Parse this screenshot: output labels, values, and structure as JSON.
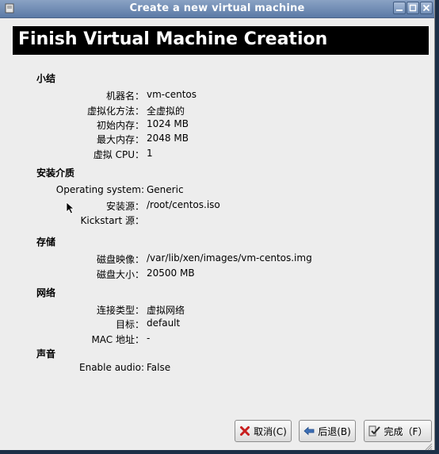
{
  "window": {
    "title": "Create a new virtual machine",
    "controls": [
      "window-menu-icon",
      "minimize-icon",
      "maximize-icon",
      "close-icon"
    ]
  },
  "banner": {
    "title": "Finish Virtual Machine Creation"
  },
  "summary": {
    "heading": "小结",
    "rows": [
      {
        "label": "机器名：",
        "value": "vm-centos"
      },
      {
        "label": "虚拟化方法：",
        "value": "全虚拟的"
      },
      {
        "label": "初始内存：",
        "value": "1024 MB"
      },
      {
        "label": "最大内存：",
        "value": "2048 MB"
      },
      {
        "label": "虚拟 CPU：",
        "value": "1"
      }
    ]
  },
  "install_media": {
    "heading": "安装介质",
    "rows": [
      {
        "label": "Operating system:",
        "value": "Generic"
      },
      {
        "label": "安装源：",
        "value": "/root/centos.iso"
      },
      {
        "label": "Kickstart 源：",
        "value": ""
      }
    ]
  },
  "storage": {
    "heading": "存储",
    "rows": [
      {
        "label": "磁盘映像：",
        "value": "/var/lib/xen/images/vm-centos.img"
      },
      {
        "label": "磁盘大小：",
        "value": "20500 MB"
      }
    ]
  },
  "network": {
    "heading": "网络",
    "rows": [
      {
        "label": "连接类型：",
        "value": "虚拟网络"
      },
      {
        "label": "目标：",
        "value": "default"
      },
      {
        "label": "MAC 地址：",
        "value": "-"
      }
    ]
  },
  "sound": {
    "heading": "声音",
    "rows": [
      {
        "label": "Enable audio:",
        "value": "False"
      }
    ]
  },
  "buttons": {
    "cancel": "取消(C)",
    "back": "后退(B)",
    "finish": "完成（F）"
  },
  "colors": {
    "titlebar": "#6d8bb4",
    "window_bg": "#ededed",
    "banner_bg": "#000000",
    "desktop": "#1c2f47"
  }
}
